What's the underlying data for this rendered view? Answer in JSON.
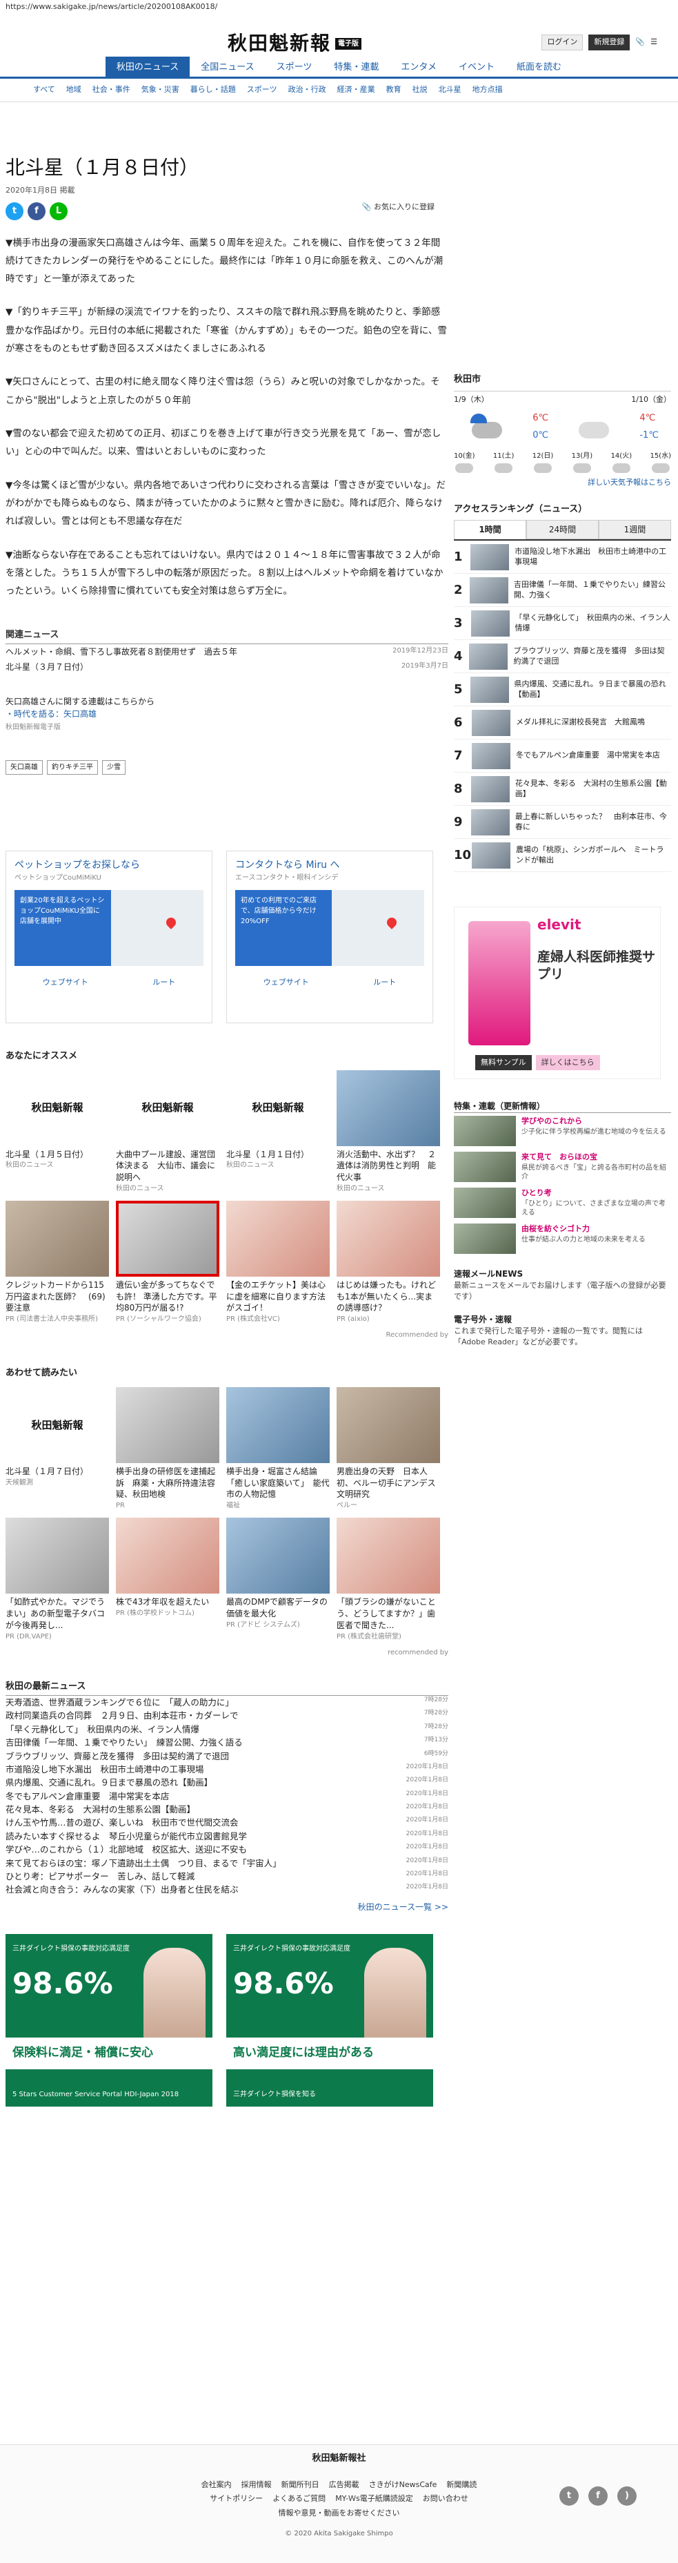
{
  "url": "https://www.sakigake.jp/news/article/20200108AK0018/",
  "header": {
    "logo": "秋田魁新報",
    "logo_badge": "電子版",
    "login": "ログイン",
    "register": "新規登録"
  },
  "gnav": [
    "秋田のニュース",
    "全国ニュース",
    "スポーツ",
    "特集・連載",
    "エンタメ",
    "イベント",
    "紙面を読む"
  ],
  "subnav": [
    "すべて",
    "地域",
    "社会・事件",
    "気象・災害",
    "暮らし・話題",
    "スポーツ",
    "政治・行政",
    "経済・産業",
    "教育",
    "社説",
    "北斗星",
    "地方点描"
  ],
  "article": {
    "title": "北斗星（１月８日付）",
    "date": "2020年1月8日 掲載",
    "fav": "お気に入りに登録",
    "paragraphs": [
      "▼横手市出身の漫画家矢口高雄さんは今年、画業５０周年を迎えた。これを機に、自作を使って３２年間続けてきたカレンダーの発行をやめることにした。最終作には「昨年１０月に命脈を救え、このへんが潮時です」と一筆が添えてあった",
      "▼「釣りキチ三平」が新緑の渓流でイワナを釣ったり、ススキの陰で群れ飛ぶ野鳥を眺めたりと、季節感豊かな作品ばかり。元日付の本紙に掲載された「寒雀（かんすずめ）」もその一つだ。鉛色の空を背に、雪が寒さをものともせず動き回るスズメはたくましさにあふれる",
      "▼矢口さんにとって、古里の村に絶え間なく降り注ぐ雪は怨（うら）みと呪いの対象でしかなかった。そこから\"脱出\"しようと上京したのが５０年前",
      "▼雪のない都会で迎えた初めての正月、初ぼこりを巻き上げて車が行き交う光景を見て「あー、雪が恋しい」と心の中で叫んだ。以来、雪はいとおしいものに変わった",
      "▼今冬は驚くほど雪が少ない。県内各地であいさつ代わりに交わされる言葉は「雪さきが変でいいな」。だがわがかでも降らぬものなら、隣まが待っていたかのように黙々と雪かきに励む。降れば厄介、降らなければ寂しい。雪とは何とも不思議な存在だ",
      "▼油断ならない存在であることも忘れてはいけない。県内では２０１４～１８年に雪害事故で３２人が命を落とした。うち１５人が雪下ろし中の転落が原因だった。８割以上はヘルメットや命綱を着けていなかったという。いくら除排雪に慣れていても安全対策は怠らず万全に。"
    ]
  },
  "related": {
    "heading": "関連ニュース",
    "items": [
      {
        "title": "ヘルメット・命綱、雪下ろし事故死者８割使用せず　過去５年",
        "date": "2019年12月23日"
      },
      {
        "title": "北斗星（３月７日付）",
        "date": "2019年3月7日"
      }
    ]
  },
  "author": {
    "heading": "矢口高雄さんに関する連載はこちらから",
    "link": "・時代を語る：矢口高雄",
    "note": "秋田魁新報電子版"
  },
  "tags": [
    "矢口高雄",
    "釣りキチ三平",
    "少雪"
  ],
  "ads_top": [
    {
      "title": "ペットショップをお探しなら",
      "sub": "ペットショップCouMiMiKU",
      "banner": "創業20年を超えるペットショップCouMiMiKU全国に店舗を展開中",
      "b1": "ウェブサイト",
      "b2": "ルート"
    },
    {
      "title": "コンタクトなら Miru へ",
      "sub": "エースコンタクト・眼科インシデ",
      "banner": "初めての利用でのご来店で、店舗価格から今だけ20%OFF",
      "b1": "ウェブサイト",
      "b2": "ルート"
    }
  ],
  "recs": {
    "heading": "あなたにオススメ",
    "by": "Recommended by",
    "items": [
      {
        "t": "北斗星（１月５日付）",
        "s": "秋田のニュース",
        "img": "logo"
      },
      {
        "t": "大曲中プール建設、運営団体決まる　大仙市、議会に説明へ",
        "s": "秋田のニュース",
        "img": "logo"
      },
      {
        "t": "北斗星（１月１日付）",
        "s": "秋田のニュース",
        "img": "logo"
      },
      {
        "t": "消火活動中、水出ず？　２遺体は消防男性と判明　能代火事",
        "s": "秋田のニュース",
        "img": "p4"
      },
      {
        "t": "クレジットカードから115万円盗まれた医師？　(69) 要注意",
        "s": "PR (司法書士法人中央事務所)",
        "img": "photo"
      },
      {
        "t": "遺伝い金が多ってちなぐでも許！ 準湧した方です。平均80万円が届る!?",
        "s": "PR (ソーシャルワーク協会)",
        "img": "p2",
        "red": true
      },
      {
        "t": "【金のエチケット】美は心に虚を細寒に自ります方法がスゴイ！",
        "s": "PR (株式会社VC)",
        "img": "p3"
      },
      {
        "t": "はじめは嫌ったも。けれども1本が無いたくら...実まの誘導感け？",
        "s": "PR (aixio)",
        "img": "p3"
      }
    ]
  },
  "also": {
    "heading": "あわせて読みたい",
    "by": "recommended by",
    "items": [
      {
        "t": "北斗星（１月７日付）",
        "s": "天候観測",
        "img": "logo"
      },
      {
        "t": "横手出身の研修医を逮捕起訴　麻薬・大麻所持違法容疑、秋田地検",
        "s": "PR",
        "img": "p2"
      },
      {
        "t": "横手出身・堀富さん結論「癒しい家庭築いて」　能代市の人物記憶",
        "s": "福祉",
        "img": "p4"
      },
      {
        "t": "男鹿出身の天野　日本人初、ベルー切手にアンデス文明研究",
        "s": "ペルー",
        "img": "photo"
      },
      {
        "t": "「如酢式やかた。マジでうまい」あの新型電子タバコが今後再発し...",
        "s": "PR (DR.VAPE)",
        "img": "p2"
      },
      {
        "t": "株で43才年収を超えたい",
        "s": "PR (株の学校ドットコム)",
        "img": "p3"
      },
      {
        "t": "最高のDMPで顧客データの価値を最大化",
        "s": "PR (アドビ システムズ)",
        "img": "p4"
      },
      {
        "t": "「頭ブラシの嫌がないことう、どうしてますか？」歯医者で聞きた...",
        "s": "PR (株式会社歯研堂)",
        "img": "p3"
      }
    ]
  },
  "latest": {
    "heading": "秋田の最新ニュース",
    "more": "秋田のニュース一覧 >>",
    "items": [
      {
        "t": "天寿酒造、世界酒蔵ランキングで６位に　「蔵人の助力に」",
        "d": "7時28分"
      },
      {
        "t": "政村同業造兵の合同葬　２月９日、由利本荘市・カダーレで",
        "d": "7時28分"
      },
      {
        "t": "「早く元静化して」　秋田県内の米、イラン人情爆",
        "d": "7時28分"
      },
      {
        "t": "吉田律儀「一年間、１乗でやりたい」　練習公開、力強く語る",
        "d": "7時13分"
      },
      {
        "t": "ブラウブリッツ、齊藤と茂を獲得　多田は契約満了で退団",
        "d": "6時59分"
      },
      {
        "t": "市道陥没し地下水漏出　秋田市土崎港中の工事現場",
        "d": "2020年1月8日"
      },
      {
        "t": "県内爆風、交通に乱れ。９日まで暴風の恐れ【動画】",
        "d": "2020年1月8日"
      },
      {
        "t": "冬でもアルペン倉庫重要　湯中常実を本店",
        "d": "2020年1月8日"
      },
      {
        "t": "花々見本、冬彩る　大潟村の生態系公園【動画】",
        "d": "2020年1月8日"
      },
      {
        "t": "けん玉や竹馬…昔の遊び、楽しいね　秋田市で世代間交流会",
        "d": "2020年1月8日"
      },
      {
        "t": "読みたい本すぐ探せるよ　琴丘小児童らが能代市立図書館見学",
        "d": "2020年1月8日"
      },
      {
        "t": "学びや…のこれから（１）北部地域　校区拡大、送迎に不安も",
        "d": "2020年1月8日"
      },
      {
        "t": "来て見ておらほの宝：塚ノ下遺跡出土土偶　つり目、まるで「宇宙人」",
        "d": "2020年1月8日"
      },
      {
        "t": "ひとり考：ピアサポーター　苦しみ、話して軽減",
        "d": "2020年1月8日"
      },
      {
        "t": "社会減と向き合う：みんなの実家（下）出身者と住民を結ぶ",
        "d": "2020年1月8日"
      }
    ]
  },
  "bot_ads": [
    {
      "sm": "三井ダイレクト損保の事故対応満足度",
      "pct": "98.6%",
      "bar": "保険料に満足・補償に安心",
      "ft": "5 Stars Customer Service Portal HDI-Japan 2018"
    },
    {
      "sm": "三井ダイレクト損保の事故対応満足度",
      "pct": "98.6%",
      "bar": "高い満足度には理由がある",
      "ft": "三井ダイレクト損保を知る"
    }
  ],
  "sidebar": {
    "weather_title": "秋田市",
    "day1": "1/9（木）",
    "day2": "1/10（金）",
    "hi1": "6℃",
    "lo1": "0℃",
    "hi2": "4℃",
    "lo2": "-1℃",
    "hours": [
      "10(金)",
      "11(土)",
      "12(日)",
      "13(月)",
      "14(火)",
      "15(水)"
    ],
    "weather_more": "詳しい天気予報はこちら",
    "rank_heading": "アクセスランキング（ニュース）",
    "rank_tabs": [
      "1時間",
      "24時間",
      "1週間"
    ],
    "ranks": [
      "市道陥没し地下水漏出　秋田市土崎港中の工事現場",
      "吉田律儀「一年間、１乗でやりたい」練習公開、力強く",
      "「早く元静化して」　秋田県内の米、イラン人情爆",
      "ブラウブリッツ、齊藤と茂を獲得　多田は契約満了で退団",
      "県内爆風、交通に乱れ。９日まで暴風の恐れ【動画】",
      "メダル拝礼に深謝校長発言　大館鳳鳴",
      "冬でもアルペン倉庫重要　湯中常実を本店",
      "花々見本、冬彩る　大潟村の生態系公園【動画】",
      "最上春に新しいちゃった？　由利本荘市、今春に",
      "農場の「桃原」、シンガポールへ　ミートランドが輸出"
    ],
    "side_ad_brand": "elevit",
    "side_ad_head": "産婦人科医師推奨サプリ",
    "side_ad_b1": "無料サンプル",
    "side_ad_b2": "詳しくはこちら",
    "feat_heading": "特集・連載（更新情報）",
    "features": [
      {
        "t": "学びやのこれから",
        "d": "少子化に伴う学校再編が進む地域の今を伝える"
      },
      {
        "t": "来て見て　おらほの宝",
        "d": "県民が誇るべき「宝」と誇る各市町村の品を紹介"
      },
      {
        "t": "ひとり考",
        "d": "「ひとり」について、さまざまな立場の声で考える"
      },
      {
        "t": "由桜を紡ぐシゴト力",
        "d": "仕事が結ぶ人の力と地域の未来を考える"
      }
    ],
    "mail_h": "速報メールNEWS",
    "mail_d": "最新ニュースをメールでお届けします（電子版への登録が必要です）",
    "paper_h": "電子号外・速報",
    "paper_d": "これまで発行した電子号外・速報の一覧です。閲覧には「Adobe Reader」などが必要です。"
  },
  "footer": {
    "logo": "秋田魁新報社",
    "links": [
      "会社案内",
      "採用情報",
      "新聞所刊日",
      "広告掲載",
      "さきがけNewsCafe",
      "新聞購読",
      "サイトポリシー",
      "よくあるご質問",
      "MY-Ｗs電子紙購読設定",
      "お問い合わせ",
      "情報や意見・動画をお寄せください"
    ],
    "copy": "© 2020 Akita Sakigake Shimpo"
  }
}
